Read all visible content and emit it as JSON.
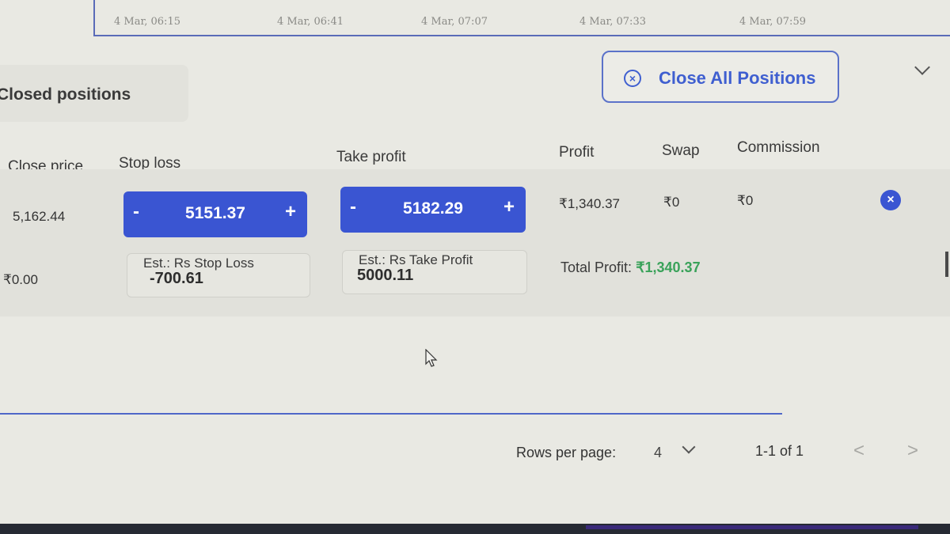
{
  "chart": {
    "times": [
      "4 Mar, 06:15",
      "4 Mar, 06:41",
      "4 Mar, 07:07",
      "4 Mar, 07:33",
      "4 Mar, 07:59"
    ]
  },
  "tab": {
    "label": "Closed positions"
  },
  "close_all": {
    "label": "Close All Positions",
    "icon": "close-circle-icon"
  },
  "headers": {
    "close_price": "Close price",
    "stop_loss": "Stop loss",
    "take_profit": "Take profit",
    "profit": "Profit",
    "swap": "Swap",
    "commission": "Commission"
  },
  "row": {
    "close_price": "5,162.44",
    "secondary_value": "₹0.00",
    "stop_loss": {
      "minus": "-",
      "value": "5151.37",
      "plus": "+"
    },
    "take_profit": {
      "minus": "-",
      "value": "5182.29",
      "plus": "+"
    },
    "profit": "₹1,340.37",
    "swap": "₹0",
    "commission": "₹0",
    "est_stop_loss": {
      "label": "Est.: Rs Stop Loss",
      "value": "-700.61"
    },
    "est_take_profit": {
      "label": "Est.: Rs Take Profit",
      "value": "5000.11"
    },
    "total_profit_label": "Total Profit:",
    "total_profit_value": "₹1,340.37"
  },
  "pagination": {
    "rows_per_page_label": "Rows per page:",
    "rows_per_page_value": "4",
    "range": "1-1 of 1",
    "prev": "<",
    "next": ">"
  },
  "colors": {
    "accent": "#3a55d2",
    "profit_green": "#3aa25a"
  }
}
